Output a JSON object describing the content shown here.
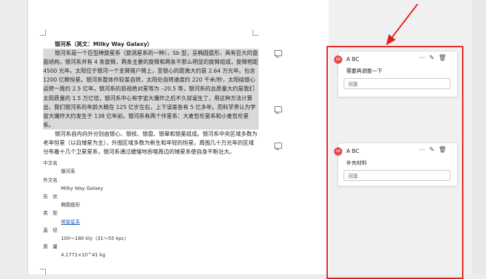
{
  "doc": {
    "title": "银河系（英文：Milky Way Galaxy）",
    "p1": "银河系是一个巨型棒旋星系（旋涡星系的一种），Sb 型，呈椭圆盘形，具有巨大的盘面结构，银河系共有 4 条旋臂，两条主要的旋臂和两条不那么明显的旋臂组成，旋臂相距 4500 光年。太阳位于银河一个支臂猎户臂上，至银心的距离大约是 2.64 万光年。包含 1200 亿颗恒星。银河系整体作较差自转，太阳处自转速度约 220 千米/秒，太阳绕银心运转一周约 2.5 亿年。银河系的目视绝对星等为 –20.5 等，银河系的总质量大约是我们太阳质量的 1.5 万亿倍，银河系中心有宇宙大爆炸之后不久就诞生了，用这种方法计算出，我们银河系的年龄大概在 125 亿岁左右，上下误差各有 5 亿多年。而科学界认为宇宙大爆炸大约发生于 138 亿年前。银河系有两个伴星系：大麦哲伦星系和小麦哲伦星系。",
    "p2": "银河系自内向外分别由银心、银核、银盘、银晕和银冕组成。银河系中央区域多数为老年恒星（以白矮星为主），外围区域多数为新生和年轻的恒星。周围几十万光年的区域分布着十几个卫星星系，银河系通过缓慢地吞噬周边的矮星系使自身不断壮大。",
    "info": [
      {
        "key": "中文名",
        "value": "银河系"
      },
      {
        "key": "外文名",
        "value": "Milky Way Galaxy"
      },
      {
        "key": "形　状",
        "value": "椭圆盘形"
      },
      {
        "key": "类　型",
        "value": "棒旋星系"
      },
      {
        "key": "直　径",
        "value": "100～180 kly（31～55 kpc）"
      },
      {
        "key": "质　量",
        "value": "4.1771×10^41 kg"
      }
    ]
  },
  "comments": [
    {
      "avatar": "AB",
      "user": "A BC",
      "text": "需要再调整一下",
      "reply_placeholder": "回复"
    },
    {
      "avatar": "AB",
      "user": "A BC",
      "text": "补充材料",
      "reply_placeholder": "回复"
    }
  ],
  "icons": {
    "more": "more-icon",
    "edit": "pencil-icon",
    "delete": "trash-icon",
    "comment": "comment-icon"
  },
  "colors": {
    "highlight_box": "#e02020",
    "avatar": "#e64545",
    "link": "#1f5fbf"
  }
}
